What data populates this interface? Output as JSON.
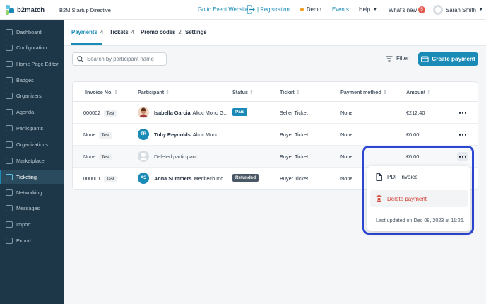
{
  "app": {
    "brand": "b2match",
    "event_title": "B2M Startup Directive",
    "nav": {
      "event_website": "Go to Event Website",
      "registration": "| Registration",
      "demo": "Demo",
      "events": "Events",
      "help": "Help",
      "whats_new": "What's new",
      "whats_new_count": "5",
      "user": "Sarah Smith"
    }
  },
  "sidebar": {
    "items": [
      {
        "label": "Dashboard"
      },
      {
        "label": "Configuration"
      },
      {
        "label": "Home Page Editor"
      },
      {
        "label": "Badges"
      },
      {
        "label": "Organizers"
      },
      {
        "label": "Agenda"
      },
      {
        "label": "Participants"
      },
      {
        "label": "Organizations"
      },
      {
        "label": "Marketplace"
      },
      {
        "label": "Ticketing"
      },
      {
        "label": "Networking"
      },
      {
        "label": "Messages"
      },
      {
        "label": "Import"
      },
      {
        "label": "Export"
      }
    ]
  },
  "tabs": [
    {
      "label": "Payments",
      "count": "4"
    },
    {
      "label": "Tickets",
      "count": "4"
    },
    {
      "label": "Promo codes",
      "count": "2"
    },
    {
      "label": "Settings",
      "count": ""
    }
  ],
  "toolbar": {
    "search_placeholder": "Search by participant name",
    "filter_label": "Filter",
    "create_label": "Create payment"
  },
  "table": {
    "headers": [
      "Invoice No.",
      "Participant",
      "Status",
      "Ticket",
      "Payment method",
      "Amount"
    ],
    "rows": [
      {
        "invoice": "000002",
        "tag": "Test",
        "initials": "",
        "name": "Isabella Garcia",
        "org": "Altuc Mond G...",
        "status": "Paid",
        "ticket": "Seller Ticket",
        "method": "None",
        "amount": "€212.40"
      },
      {
        "invoice": "None",
        "tag": "Test",
        "initials": "TR",
        "name": "Toby Reynolds",
        "org": "Altuc Mond",
        "status": "",
        "ticket": "Buyer Ticket",
        "method": "None",
        "amount": "€0.00"
      },
      {
        "invoice": "None",
        "tag": "Test",
        "initials": "",
        "name": "Deleted participant",
        "org": "",
        "status": "",
        "ticket": "Buyer Ticket",
        "method": "None",
        "amount": "€0.00"
      },
      {
        "invoice": "000001",
        "tag": "Test",
        "initials": "AS",
        "name": "Anna Summers",
        "org": "Meditech Inc.",
        "status": "Refunded",
        "ticket": "Buyer Ticket",
        "method": "None",
        "amount": ""
      }
    ]
  },
  "menu": {
    "pdf_invoice": "PDF Invoice",
    "delete_payment": "Delete payment",
    "last_updated": "Last updated on Dec 08, 2023 at 11:26."
  },
  "colors": {
    "accent": "#1a8ab6",
    "sidebar": "#1d3748",
    "paid": "#1a8ab6",
    "refunded": "#4a5866",
    "danger": "#d0392b",
    "highlight": "#2c47d4"
  }
}
